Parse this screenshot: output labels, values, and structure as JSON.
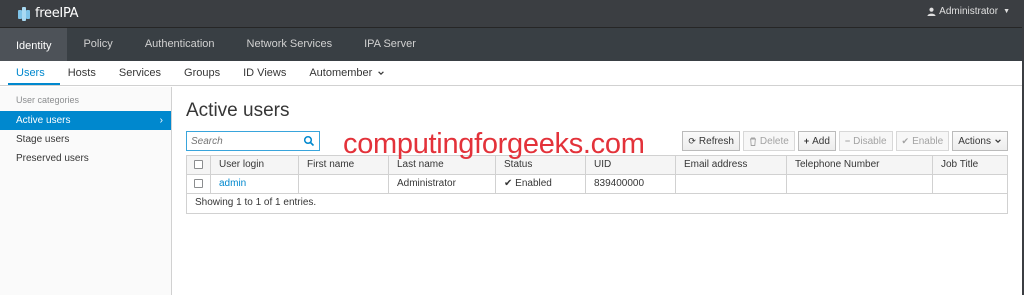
{
  "app": {
    "brand": "freeIPA",
    "user": "Administrator"
  },
  "nav_primary": [
    "Identity",
    "Policy",
    "Authentication",
    "Network Services",
    "IPA Server"
  ],
  "nav_secondary": [
    "Users",
    "Hosts",
    "Services",
    "Groups",
    "ID Views",
    "Automember"
  ],
  "sidebar": {
    "category": "User categories",
    "items": [
      "Active users",
      "Stage users",
      "Preserved users"
    ]
  },
  "page": {
    "title": "Active users"
  },
  "search": {
    "placeholder": "Search"
  },
  "toolbar": {
    "refresh": "Refresh",
    "delete": "Delete",
    "add": "Add",
    "disable": "Disable",
    "enable": "Enable",
    "actions": "Actions"
  },
  "table": {
    "columns": [
      "User login",
      "First name",
      "Last name",
      "Status",
      "UID",
      "Email address",
      "Telephone Number",
      "Job Title"
    ],
    "rows": [
      {
        "login": "admin",
        "first": "",
        "last": "Administrator",
        "status": "Enabled",
        "uid": "839400000",
        "email": "",
        "phone": "",
        "job": ""
      }
    ],
    "footer": "Showing 1 to 1 of 1 entries."
  },
  "watermark": "computingforgeeks.com",
  "colors": {
    "accent": "#0088ce",
    "topbar": "#3b3e42",
    "nav": "#393f44",
    "watermark": "#e3323a"
  }
}
